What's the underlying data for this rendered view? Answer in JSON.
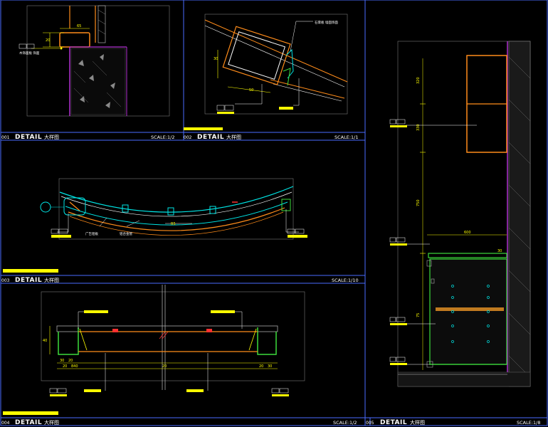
{
  "sheet": {
    "panels": [
      {
        "id": "001",
        "number": "001",
        "title": "DETAIL",
        "subtitle": "大样图",
        "scale": "SCALE:1/2"
      },
      {
        "id": "002",
        "number": "002",
        "title": "DETAIL",
        "subtitle": "大样图",
        "scale": "SCALE:1/1"
      },
      {
        "id": "003",
        "number": "003",
        "title": "DETAIL",
        "subtitle": "大样图",
        "scale": "SCALE:1/10"
      },
      {
        "id": "004",
        "number": "004",
        "title": "DETAIL",
        "subtitle": "大样图",
        "scale": "SCALE:1/2"
      },
      {
        "id": "005",
        "number": "005",
        "title": "DETAIL",
        "subtitle": "大样图",
        "scale": "SCALE:1/8"
      }
    ]
  },
  "detail_001": {
    "dims": [
      "65",
      "20"
    ],
    "note": "木饰面板 饰面"
  },
  "detail_002": {
    "dims": [
      "30",
      "50"
    ],
    "note": "石膏板 墙面饰面"
  },
  "detail_003": {
    "dims": [
      "R5"
    ],
    "notes": [
      "广告铝板",
      "铝合金管"
    ]
  },
  "detail_004": {
    "dims": [
      "40",
      "30",
      "20",
      "20",
      "840",
      "20",
      "20",
      "30"
    ]
  },
  "detail_005": {
    "dims": [
      "320",
      "330",
      "750",
      "600",
      "30",
      "75"
    ]
  },
  "colors": {
    "background": "#000000",
    "frame": "#4a6cff",
    "title_text": "#ffffff",
    "dimension": "#ffff00",
    "finish_orange": "#ff8c1a",
    "wall_purple": "#b030d0",
    "green_outline": "#3cdc3c",
    "cyan_line": "#00e5e5",
    "highlight_bar": "#ffff00"
  }
}
